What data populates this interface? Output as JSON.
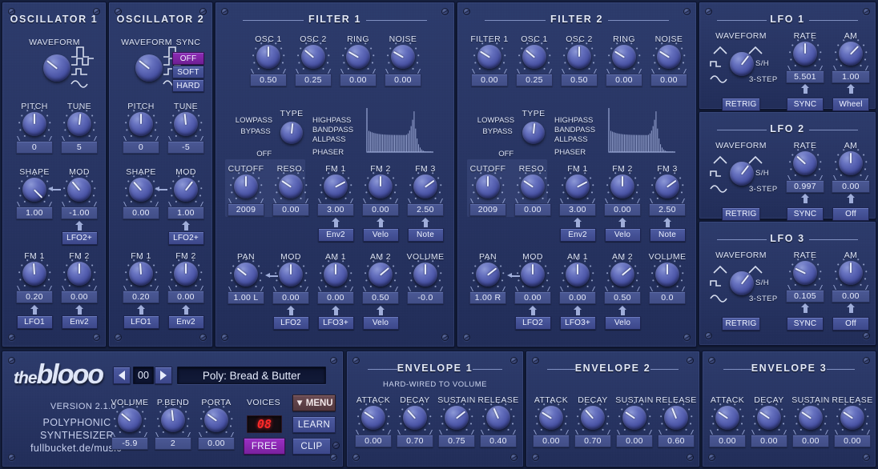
{
  "app": {
    "name": "the blooo",
    "logo_the": "the",
    "logo_main": "blooo",
    "version": "VERSION 2.1.0",
    "type_line1": "POLYPHONIC",
    "type_line2": "SYNTHESIZER",
    "url": "fullbucket.de/music",
    "accent_purple": "#8e2bb5",
    "panel_blue": "#263463",
    "knob_blue": "#4b55a6",
    "led_red": "#ff2a2a"
  },
  "osc1": {
    "title": "OSCILLATOR 1",
    "waveform_label": "WAVEFORM",
    "waveform_angle": -52,
    "controls": [
      {
        "label": "PITCH",
        "value": "0",
        "angle": 0
      },
      {
        "label": "TUNE",
        "value": "5",
        "angle": 6
      },
      {
        "label": "SHAPE",
        "value": "1.00",
        "angle": 135
      },
      {
        "label": "MOD",
        "value": "-1.00",
        "angle": -40,
        "mod": "LFO2+"
      },
      {
        "label": "FM 1",
        "value": "0.20",
        "angle": -4,
        "mod": "LFO1"
      },
      {
        "label": "FM 2",
        "value": "0.00",
        "angle": 0,
        "mod": "Env2"
      }
    ]
  },
  "osc2": {
    "title": "OSCILLATOR 2",
    "waveform_label": "WAVEFORM",
    "waveform_angle": -52,
    "sync_label": "SYNC",
    "sync_options": [
      "OFF",
      "SOFT",
      "HARD"
    ],
    "sync_selected": "OFF",
    "controls": [
      {
        "label": "PITCH",
        "value": "0",
        "angle": 0
      },
      {
        "label": "TUNE",
        "value": "-5",
        "angle": -6
      },
      {
        "label": "SHAPE",
        "value": "0.00",
        "angle": -42
      },
      {
        "label": "MOD",
        "value": "1.00",
        "angle": 38,
        "mod": "LFO2+"
      },
      {
        "label": "FM 1",
        "value": "0.20",
        "angle": -4,
        "mod": "LFO1"
      },
      {
        "label": "FM 2",
        "value": "0.00",
        "angle": 0,
        "mod": "Env2"
      }
    ]
  },
  "filter1": {
    "title": "FILTER 1",
    "sources": [
      {
        "label": "OSC 1",
        "value": "0.50",
        "angle": 0
      },
      {
        "label": "OSC 2",
        "value": "0.25",
        "angle": -50
      },
      {
        "label": "RING",
        "value": "0.00",
        "angle": -60
      },
      {
        "label": "NOISE",
        "value": "0.00",
        "angle": -60
      }
    ],
    "type_label": "TYPE",
    "type_left": [
      "LOWPASS",
      "BYPASS",
      "OFF"
    ],
    "type_right": [
      "HIGHPASS",
      "BANDPASS",
      "ALLPASS",
      "PHASER"
    ],
    "type_angle": 6,
    "row2": [
      {
        "label": "CUTOFF",
        "value": "2009",
        "angle": 0,
        "highlight": true
      },
      {
        "label": "RESO.",
        "value": "0.00",
        "angle": -56,
        "highlight": true
      },
      {
        "label": "FM 1",
        "value": "3.00",
        "angle": 62,
        "mod": "Env2"
      },
      {
        "label": "FM 2",
        "value": "0.00",
        "angle": 0,
        "mod": "Velo"
      },
      {
        "label": "FM 3",
        "value": "2.50",
        "angle": 54,
        "mod": "Note"
      }
    ],
    "row3": [
      {
        "label": "PAN",
        "value": "1.00 L",
        "angle": -52
      },
      {
        "label": "MOD",
        "value": "0.00",
        "angle": 0,
        "mod": "LFO2"
      },
      {
        "label": "AM 1",
        "value": "0.00",
        "angle": 0,
        "mod": "LFO3+"
      },
      {
        "label": "AM 2",
        "value": "0.50",
        "angle": 50,
        "mod": "Velo"
      },
      {
        "label": "VOLUME",
        "value": "-0.0",
        "angle": 0
      }
    ]
  },
  "filter2": {
    "title": "FILTER 2",
    "sources": [
      {
        "label": "FILTER 1",
        "value": "0.00",
        "angle": -58
      },
      {
        "label": "OSC 1",
        "value": "0.25",
        "angle": -50
      },
      {
        "label": "OSC 2",
        "value": "0.50",
        "angle": 0
      },
      {
        "label": "RING",
        "value": "0.00",
        "angle": -58
      },
      {
        "label": "NOISE",
        "value": "0.00",
        "angle": -58
      }
    ],
    "type_label": "TYPE",
    "type_left": [
      "LOWPASS",
      "BYPASS",
      "OFF"
    ],
    "type_right": [
      "HIGHPASS",
      "BANDPASS",
      "ALLPASS",
      "PHASER"
    ],
    "type_angle": 6,
    "row2": [
      {
        "label": "CUTOFF",
        "value": "2009",
        "angle": 0,
        "highlight": true
      },
      {
        "label": "RESO.",
        "value": "0.00",
        "angle": -56,
        "highlight": true
      },
      {
        "label": "FM 1",
        "value": "3.00",
        "angle": 62,
        "mod": "Env2"
      },
      {
        "label": "FM 2",
        "value": "0.00",
        "angle": 0,
        "mod": "Velo"
      },
      {
        "label": "FM 3",
        "value": "2.50",
        "angle": 54,
        "mod": "Note"
      }
    ],
    "row3": [
      {
        "label": "PAN",
        "value": "1.00 R",
        "angle": 52
      },
      {
        "label": "MOD",
        "value": "0.00",
        "angle": 0,
        "mod": "LFO2"
      },
      {
        "label": "AM 1",
        "value": "0.00",
        "angle": 0,
        "mod": "LFO3+"
      },
      {
        "label": "AM 2",
        "value": "0.50",
        "angle": 50,
        "mod": "Velo"
      },
      {
        "label": "VOLUME",
        "value": "0.0",
        "angle": 0
      }
    ]
  },
  "lfos": [
    {
      "title": "LFO 1",
      "waveform_label": "WAVEFORM",
      "waveform_angle": 38,
      "sh_label": "S/H",
      "step_label": "3-STEP",
      "retrig_label": "RETRIG",
      "rate_label": "RATE",
      "rate_value": "5.501",
      "rate_angle": 0,
      "rate_mod": "SYNC",
      "am_label": "AM",
      "am_value": "1.00",
      "am_angle": 44,
      "am_mod": "Wheel"
    },
    {
      "title": "LFO 2",
      "waveform_label": "WAVEFORM",
      "waveform_angle": 38,
      "sh_label": "S/H",
      "step_label": "3-STEP",
      "retrig_label": "RETRIG",
      "rate_label": "RATE",
      "rate_value": "0.997",
      "rate_angle": -48,
      "rate_mod": "SYNC",
      "am_label": "AM",
      "am_value": "0.00",
      "am_angle": 0,
      "am_mod": "Off"
    },
    {
      "title": "LFO 3",
      "waveform_label": "WAVEFORM",
      "waveform_angle": 38,
      "sh_label": "S/H",
      "step_label": "3-STEP",
      "retrig_label": "RETRIG",
      "rate_label": "RATE",
      "rate_value": "0.105",
      "rate_angle": -64,
      "rate_mod": "SYNC",
      "am_label": "AM",
      "am_value": "0.00",
      "am_angle": 0,
      "am_mod": "Off"
    }
  ],
  "master": {
    "preset_index": "00",
    "preset_name": "Poly: Bread & Butter",
    "prev_icon": "triangle-left-icon",
    "next_icon": "triangle-right-icon",
    "menu_label": "MENU",
    "learn_label": "LEARN",
    "clip_label": "CLIP",
    "free_label": "FREE",
    "voices_label": "VOICES",
    "voices_value": "08",
    "controls": [
      {
        "label": "VOLUME",
        "value": "-5.9",
        "angle": -50
      },
      {
        "label": "P.BEND",
        "value": "2",
        "angle": -6
      },
      {
        "label": "PORTA",
        "value": "0.00",
        "angle": -54
      }
    ]
  },
  "envelopes": [
    {
      "title": "ENVELOPE 1",
      "subtitle": "HARD-WIRED TO VOLUME",
      "controls": [
        {
          "label": "ATTACK",
          "value": "0.00",
          "angle": -56
        },
        {
          "label": "DECAY",
          "value": "0.70",
          "angle": -42
        },
        {
          "label": "SUSTAIN",
          "value": "0.75",
          "angle": 52
        },
        {
          "label": "RELEASE",
          "value": "0.40",
          "angle": -24
        }
      ]
    },
    {
      "title": "ENVELOPE 2",
      "subtitle": "",
      "controls": [
        {
          "label": "ATTACK",
          "value": "0.00",
          "angle": -58
        },
        {
          "label": "DECAY",
          "value": "0.70",
          "angle": -42
        },
        {
          "label": "SUSTAIN",
          "value": "0.00",
          "angle": -56
        },
        {
          "label": "RELEASE",
          "value": "0.60",
          "angle": -22
        }
      ]
    },
    {
      "title": "ENVELOPE 3",
      "subtitle": "",
      "controls": [
        {
          "label": "ATTACK",
          "value": "0.00",
          "angle": -56
        },
        {
          "label": "DECAY",
          "value": "0.00",
          "angle": -56
        },
        {
          "label": "SUSTAIN",
          "value": "0.00",
          "angle": -56
        },
        {
          "label": "RELEASE",
          "value": "0.00",
          "angle": -56
        }
      ]
    }
  ]
}
